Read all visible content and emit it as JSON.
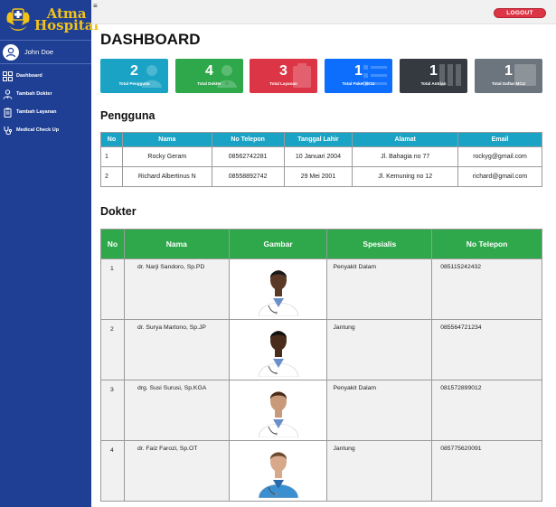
{
  "app": {
    "logo_line1": "Atma",
    "logo_line2": "Hospital",
    "user_name": "John Doe",
    "accent": "#1e3f94",
    "logo_color": "#f2c21a"
  },
  "sidebar": {
    "items": [
      {
        "label": "Dashboard",
        "icon": "dashboard-grid-icon"
      },
      {
        "label": "Tambah Dokter",
        "icon": "doctor-icon"
      },
      {
        "label": "Tambah Layanan",
        "icon": "clipboard-icon"
      },
      {
        "label": "Medical Check Up",
        "icon": "stethoscope-icon"
      }
    ]
  },
  "topbar": {
    "menu_icon": "≡",
    "logout_label": "LOGOUT",
    "logout_color": "#dc3545"
  },
  "page": {
    "title": "DASHBOARD"
  },
  "cards": [
    {
      "value": "2",
      "label": "Total Pengguna",
      "color": "#1aa3c4",
      "icon": "users-icon"
    },
    {
      "value": "4",
      "label": "Total Dokter",
      "color": "#2ea84a",
      "icon": "doctor-icon"
    },
    {
      "value": "3",
      "label": "Total Layanan",
      "color": "#dc3545",
      "icon": "clipboard-icon"
    },
    {
      "value": "1",
      "label": "Total Paket MCU",
      "color": "#0d6efd",
      "icon": "list-icon"
    },
    {
      "value": "1",
      "label": "Total Antrian",
      "color": "#343a40",
      "icon": "queue-icon"
    },
    {
      "value": "1",
      "label": "Total Daftar MCU",
      "color": "#6c757d",
      "icon": "list-check-icon"
    }
  ],
  "pengguna": {
    "title": "Pengguna",
    "headers": [
      "No",
      "Nama",
      "No Telepon",
      "Tanggal Lahir",
      "Alamat",
      "Email"
    ],
    "rows": [
      [
        "1",
        "Rocky Geram",
        "08562742281",
        "10 Januari 2004",
        "Jl. Bahagia no 77",
        "rockyg@gmail.com"
      ],
      [
        "2",
        "Richard Albertinus N",
        "08558892742",
        "29 Mei 2001",
        "Jl. Kemuning no 12",
        "richard@gmail.com"
      ]
    ]
  },
  "dokter": {
    "title": "Dokter",
    "headers": [
      "No",
      "Nama",
      "Gambar",
      "Spesialis",
      "No Telepon"
    ],
    "rows": [
      {
        "no": "1",
        "nama": "dr. Narji Sandoro, Sp.PD",
        "spesialis": "Penyakit Dalam",
        "telepon": "085115242432",
        "skin": "#5a3a26",
        "coat": "#ffffff",
        "hair": "#1a1a1a"
      },
      {
        "no": "2",
        "nama": "dr. Surya Martono, Sp.JP",
        "spesialis": "Jantung",
        "telepon": "085564721234",
        "skin": "#4a2c1d",
        "coat": "#ffffff",
        "hair": "#111111"
      },
      {
        "no": "3",
        "nama": "drg. Susi Surusi, Sp.KGA",
        "spesialis": "Penyakit Dalam",
        "telepon": "081572899012",
        "skin": "#c99a7a",
        "coat": "#ffffff",
        "hair": "#4a2c1a"
      },
      {
        "no": "4",
        "nama": "dr. Faiz Farozi, Sp.OT",
        "spesialis": "Jantung",
        "telepon": "085775620091",
        "skin": "#d7a98a",
        "coat": "#3a8fd1",
        "hair": "#6a4a30"
      }
    ]
  }
}
